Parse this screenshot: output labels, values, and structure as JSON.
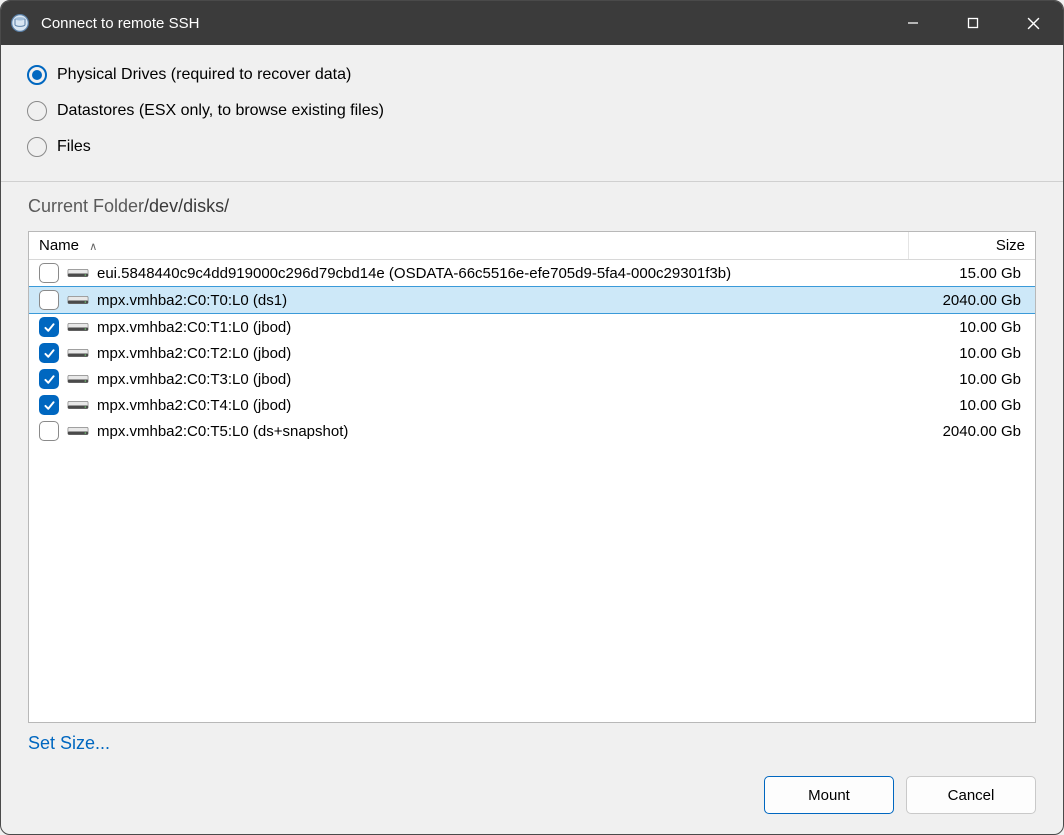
{
  "window": {
    "title": "Connect to remote SSH"
  },
  "radios": {
    "options": [
      {
        "label": "Physical Drives (required to recover data)",
        "checked": true
      },
      {
        "label": "Datastores (ESX only, to browse existing files)",
        "checked": false
      },
      {
        "label": "Files",
        "checked": false
      }
    ]
  },
  "folder": {
    "label_prefix": "Current Folder",
    "path": "/dev/disks/"
  },
  "table": {
    "columns": {
      "name": "Name",
      "size": "Size"
    },
    "rows": [
      {
        "checked": false,
        "selected": false,
        "name": "eui.5848440c9c4dd919000c296d79cbd14e (OSDATA-66c5516e-efe705d9-5fa4-000c29301f3b)",
        "size": "15.00 Gb"
      },
      {
        "checked": false,
        "selected": true,
        "name": "mpx.vmhba2:C0:T0:L0 (ds1)",
        "size": "2040.00 Gb"
      },
      {
        "checked": true,
        "selected": false,
        "name": "mpx.vmhba2:C0:T1:L0 (jbod)",
        "size": "10.00 Gb"
      },
      {
        "checked": true,
        "selected": false,
        "name": "mpx.vmhba2:C0:T2:L0 (jbod)",
        "size": "10.00 Gb"
      },
      {
        "checked": true,
        "selected": false,
        "name": "mpx.vmhba2:C0:T3:L0 (jbod)",
        "size": "10.00 Gb"
      },
      {
        "checked": true,
        "selected": false,
        "name": "mpx.vmhba2:C0:T4:L0 (jbod)",
        "size": "10.00 Gb"
      },
      {
        "checked": false,
        "selected": false,
        "name": "mpx.vmhba2:C0:T5:L0 (ds+snapshot)",
        "size": "2040.00 Gb"
      }
    ]
  },
  "links": {
    "set_size": "Set Size..."
  },
  "buttons": {
    "mount": "Mount",
    "cancel": "Cancel"
  }
}
